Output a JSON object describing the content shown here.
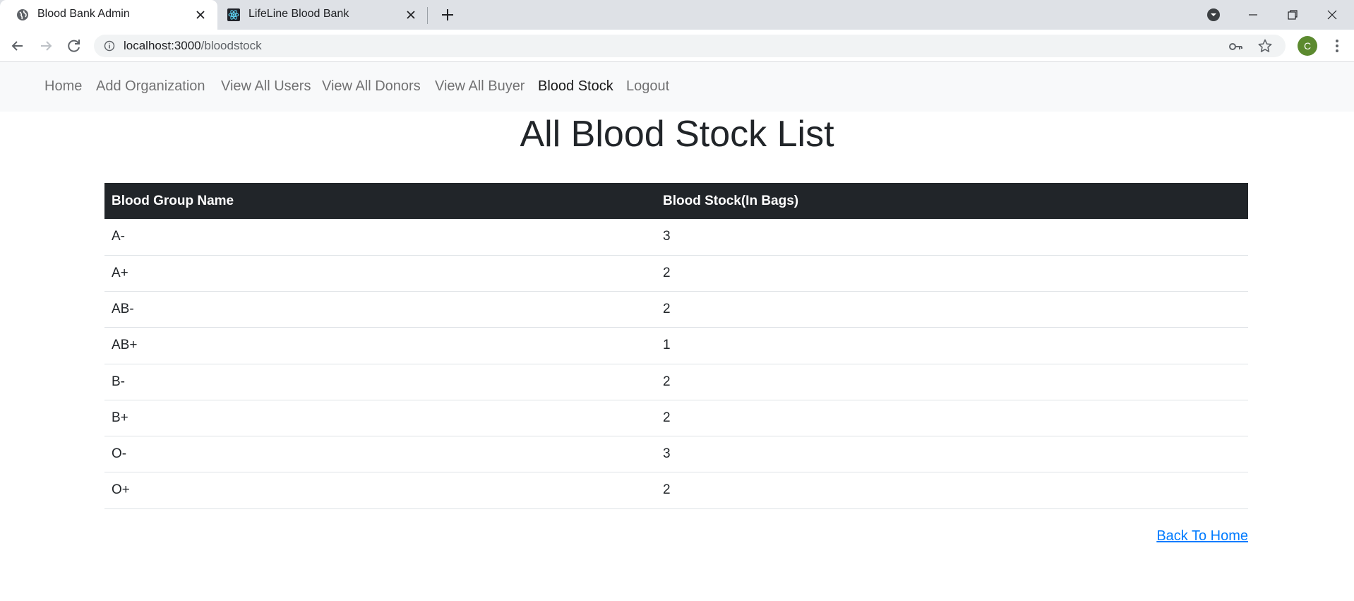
{
  "browser": {
    "tabs": [
      {
        "title": "Blood Bank Admin",
        "active": true,
        "icon": "globe-icon"
      },
      {
        "title": "LifeLine Blood Bank",
        "active": false,
        "icon": "react-logo-icon"
      }
    ],
    "url_host": "localhost:3000",
    "url_path": "/bloodstock",
    "profile_initial": "C"
  },
  "nav": {
    "items": [
      {
        "label": "Home"
      },
      {
        "label": "Add Organization"
      },
      {
        "label": "View All Users"
      },
      {
        "label": "View All Donors"
      },
      {
        "label": "View All Buyer"
      },
      {
        "label": "Blood Stock",
        "active": true
      },
      {
        "label": "Logout"
      }
    ]
  },
  "page": {
    "title": "All Blood Stock List",
    "back_link": "Back To Home"
  },
  "table": {
    "headers": [
      "Blood Group Name",
      "Blood Stock(In Bags)"
    ],
    "rows": [
      [
        "A-",
        "3"
      ],
      [
        "A+",
        "2"
      ],
      [
        "AB-",
        "2"
      ],
      [
        "AB+",
        "1"
      ],
      [
        "B-",
        "2"
      ],
      [
        "B+",
        "2"
      ],
      [
        "O-",
        "3"
      ],
      [
        "O+",
        "2"
      ]
    ]
  },
  "colors": {
    "header_bg": "#212529",
    "nav_bg": "#f8f9fa",
    "link": "#007bff",
    "profile": "#5c8a2f"
  }
}
